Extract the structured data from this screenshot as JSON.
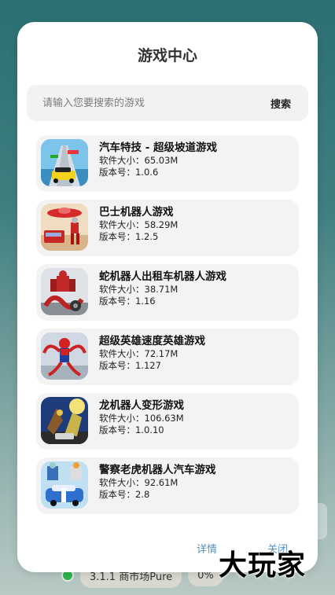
{
  "background": {
    "version_label": "3.1.1",
    "market_label": "商市场Pure",
    "percent_label": "0%"
  },
  "dialog": {
    "title": "游戏中心",
    "search": {
      "placeholder": "请输入您要搜索的游戏",
      "button": "搜索"
    },
    "size_prefix": "软件大小：",
    "version_prefix": "版本号：",
    "games": [
      {
        "name": "汽车特技 - 超级坡道游戏",
        "size": "软件大小：65.03M",
        "version": "版本号：1.0.6",
        "icon": "stunt-car-ramp-icon"
      },
      {
        "name": "巴士机器人游戏",
        "size": "软件大小：58.29M",
        "version": "版本号：1.2.5",
        "icon": "bus-robot-ufo-icon"
      },
      {
        "name": "蛇机器人出租车机器人游戏",
        "size": "软件大小：38.71M",
        "version": "版本号：1.16",
        "icon": "snake-robot-taxi-icon"
      },
      {
        "name": "超级英雄速度英雄游戏",
        "size": "软件大小：72.17M",
        "version": "版本号：1.127",
        "icon": "spider-hero-icon"
      },
      {
        "name": "龙机器人变形游戏",
        "size": "软件大小：106.63M",
        "version": "版本号：1.0.10",
        "icon": "dragon-robot-icon"
      },
      {
        "name": "警察老虎机器人汽车游戏",
        "size": "软件大小：92.61M",
        "version": "版本号：2.8",
        "icon": "police-tiger-robot-icon"
      }
    ],
    "footer": {
      "detail": "详情",
      "close": "关闭"
    }
  },
  "watermark": "大玩家"
}
